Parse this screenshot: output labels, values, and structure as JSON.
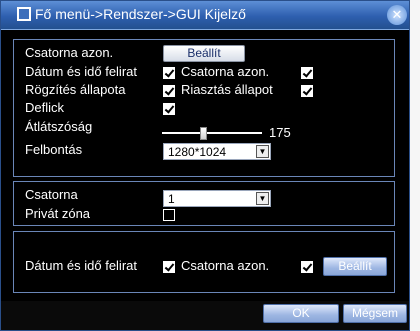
{
  "title": "Fő menü->Rendszer->GUI Kijelző",
  "section1": {
    "channel_name_label": "Csatorna azon.",
    "channel_name_button": "Beállít",
    "datetime_label": "Dátum és idő felirat",
    "datetime_checked": true,
    "channel_id_label": "Csatorna azon.",
    "channel_id_checked": true,
    "record_status_label": "Rögzítés állapota",
    "record_status_checked": true,
    "alarm_status_label": "Riasztás állapot",
    "alarm_status_checked": true,
    "deflick_label": "Deflick",
    "deflick_checked": true,
    "transparency_label": "Átlátszóság",
    "transparency_value": "175",
    "transparency_level": 175,
    "transparency_max": 255,
    "resolution_label": "Felbontás",
    "resolution_value": "1280*1024"
  },
  "section2": {
    "channel_label": "Csatorna",
    "channel_value": "1",
    "privacy_zone_label": "Privát zóna",
    "privacy_zone_checked": false
  },
  "section3": {
    "datetime_label": "Dátum és idő felirat",
    "datetime_checked": true,
    "channel_id_label": "Csatorna azon.",
    "channel_id_checked": true,
    "set_button": "Beállít"
  },
  "buttons": {
    "ok": "OK",
    "cancel": "Mégsem"
  },
  "icons": {
    "title_icon": "window-icon",
    "close_icon": "close-icon",
    "dropdown_icon": "chevron-down-icon"
  }
}
